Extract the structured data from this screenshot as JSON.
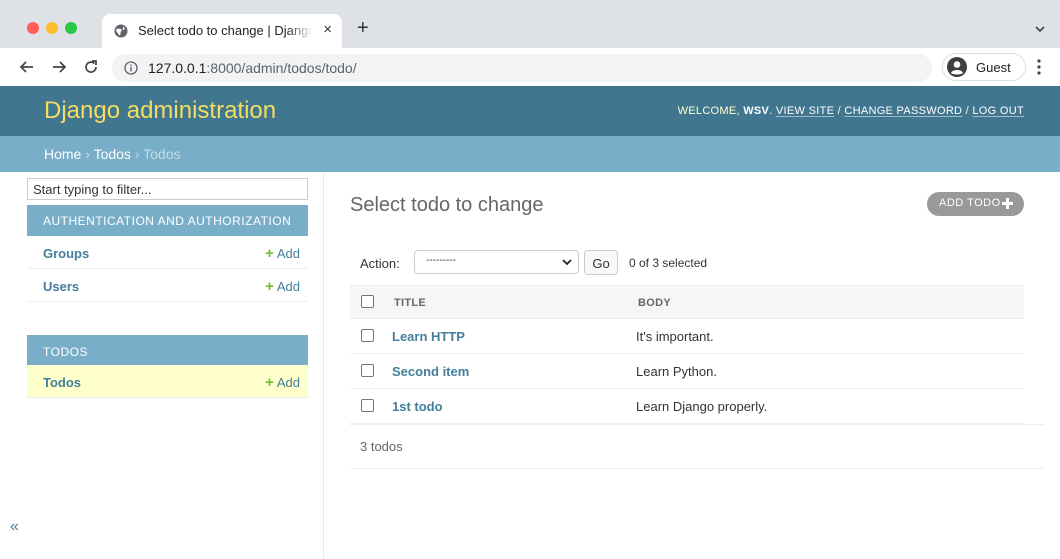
{
  "browser": {
    "tab_title": "Select todo to change | Django site admin",
    "tab_close": "×",
    "new_tab": "+",
    "url_host": "127.0.0.1",
    "url_rest": ":8000/admin/todos/todo/",
    "profile_label": "Guest",
    "icons": [
      "globe-icon",
      "back-arrow-icon",
      "forward-arrow-icon",
      "reload-icon",
      "info-icon",
      "profile-icon",
      "kebab-menu-icon",
      "chevron-down-icon"
    ]
  },
  "header": {
    "brand": "Django administration",
    "welcome": "WELCOME, ",
    "username": "WSV",
    "view_site": "VIEW SITE",
    "change_password": "CHANGE PASSWORD",
    "log_out": "LOG OUT",
    "separator": " / ",
    "colors": {
      "header_bg": "#417690",
      "brand": "#f5dd5d",
      "breadcrumbs_bg": "#79aec8"
    }
  },
  "breadcrumbs": {
    "home": "Home",
    "app": "Todos",
    "current": "Todos",
    "separator": " › "
  },
  "sidebar": {
    "filter_placeholder": "Start typing to filter...",
    "apps": [
      {
        "caption": "AUTHENTICATION AND AUTHORIZATION",
        "models": [
          {
            "label": "Groups",
            "add": "Add"
          },
          {
            "label": "Users",
            "add": "Add"
          }
        ]
      },
      {
        "caption": "TODOS",
        "models": [
          {
            "label": "Todos",
            "add": "Add",
            "selected": true
          }
        ]
      }
    ],
    "collapse_label": "«"
  },
  "main": {
    "title": "Select todo to change",
    "add_button": "ADD TODO",
    "action_label": "Action:",
    "action_selected": "---------",
    "go_label": "Go",
    "counter": "0 of 3 selected",
    "columns": [
      "TITLE",
      "BODY"
    ],
    "rows": [
      {
        "title": "Learn HTTP",
        "body": "It's important."
      },
      {
        "title": "Second item",
        "body": "Learn Python."
      },
      {
        "title": "1st todo",
        "body": "Learn Django properly."
      }
    ],
    "paginator": "3 todos",
    "colors": {
      "link": "#447e9b",
      "add_green": "#70bf2b",
      "selected_row": "#ffffcc"
    }
  }
}
